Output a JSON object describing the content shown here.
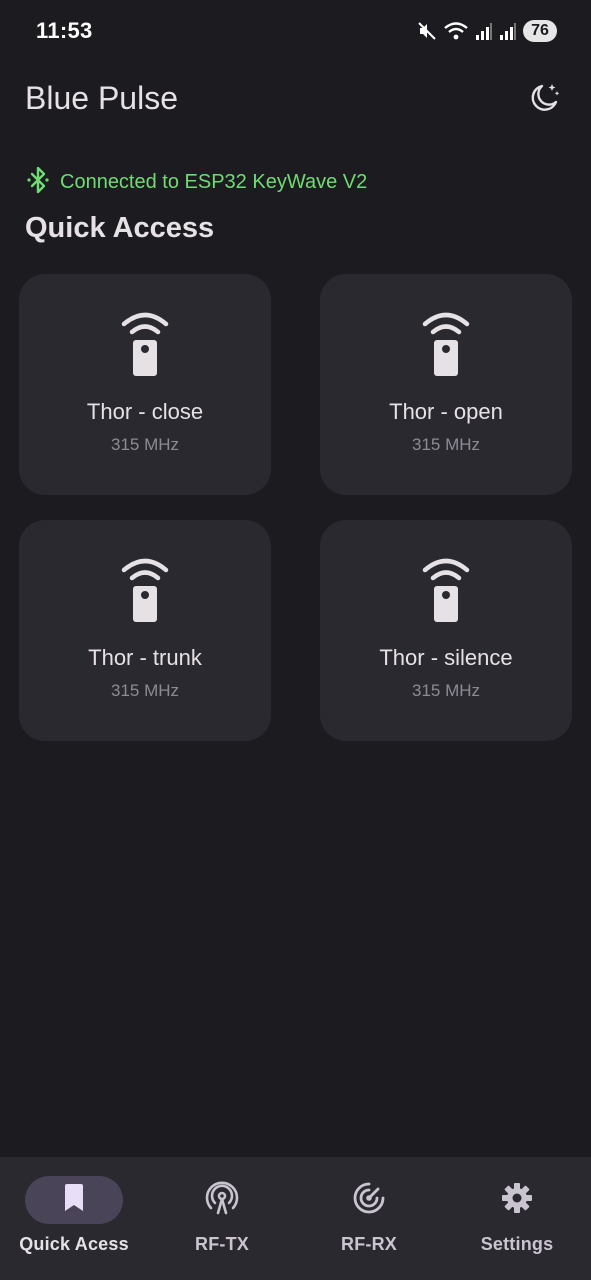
{
  "status_bar": {
    "time": "11:53",
    "battery": "76",
    "icons": [
      "mute-icon",
      "wifi-icon",
      "signal-icon",
      "signal-icon-2",
      "battery-icon"
    ]
  },
  "header": {
    "title": "Blue Pulse",
    "theme_icon": "moon-stars-icon"
  },
  "connection": {
    "icon": "bluetooth-icon",
    "text": "Connected to ESP32 KeyWave V2",
    "color": "#6fdc73"
  },
  "quick_access": {
    "title": "Quick Access",
    "cards": [
      {
        "name": "Thor - close",
        "frequency": "315 MHz",
        "icon": "remote-signal-icon"
      },
      {
        "name": "Thor - open",
        "frequency": "315 MHz",
        "icon": "remote-signal-icon"
      },
      {
        "name": "Thor - trunk",
        "frequency": "315 MHz",
        "icon": "remote-signal-icon"
      },
      {
        "name": "Thor - silence",
        "frequency": "315 MHz",
        "icon": "remote-signal-icon"
      }
    ]
  },
  "bottom_nav": {
    "items": [
      {
        "label": "Quick Acess",
        "icon": "bookmark-icon",
        "active": true
      },
      {
        "label": "RF-TX",
        "icon": "antenna-icon",
        "active": false
      },
      {
        "label": "RF-RX",
        "icon": "radar-icon",
        "active": false
      },
      {
        "label": "Settings",
        "icon": "gear-icon",
        "active": false
      }
    ]
  },
  "colors": {
    "background": "#1c1b1f",
    "card": "#2b2930",
    "accent_pill": "#4a4458",
    "connected_green": "#6fdc73"
  }
}
